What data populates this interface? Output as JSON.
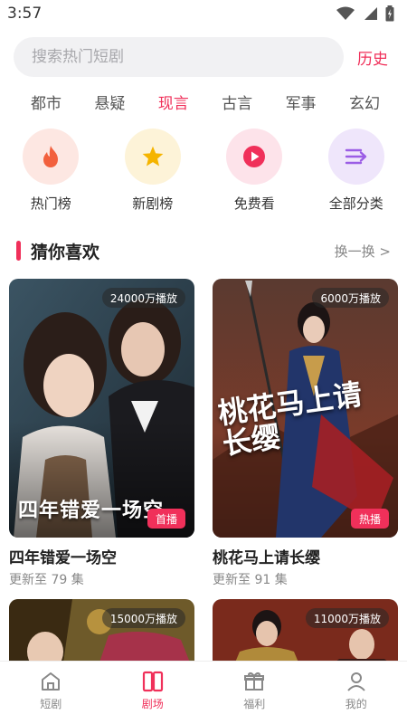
{
  "status_bar": {
    "time": "3:57"
  },
  "search": {
    "placeholder": "搜索热门短剧",
    "history_label": "历史"
  },
  "category_tabs": [
    {
      "label": "都市"
    },
    {
      "label": "悬疑"
    },
    {
      "label": "现言",
      "active": true
    },
    {
      "label": "古言"
    },
    {
      "label": "军事"
    },
    {
      "label": "玄幻"
    }
  ],
  "quick_entries": [
    {
      "label": "热门榜",
      "icon": "flame-icon",
      "bg": "#fde7e2",
      "color": "#f2603d"
    },
    {
      "label": "新剧榜",
      "icon": "star-icon",
      "bg": "#fdf3d8",
      "color": "#f5b400"
    },
    {
      "label": "免费看",
      "icon": "play-circle-icon",
      "bg": "#fde3ea",
      "color": "#f0305a"
    },
    {
      "label": "全部分类",
      "icon": "list-arrow-icon",
      "bg": "#efe6fb",
      "color": "#9b5de5"
    }
  ],
  "section": {
    "title": "猜你喜欢",
    "more_label": "换一换 >"
  },
  "cards": [
    {
      "plays": "24000万播放",
      "poster_title": "四年错爱一场空",
      "tag": "首播",
      "title": "四年错爱一场空",
      "subtitle": "更新至 79 集"
    },
    {
      "plays": "6000万播放",
      "poster_title": "桃花马上请长缨",
      "tag": "热播",
      "title": "桃花马上请长缨",
      "subtitle": "更新至 91 集"
    },
    {
      "plays": "15000万播放"
    },
    {
      "plays": "11000万播放"
    }
  ],
  "bottom_nav": [
    {
      "label": "短剧",
      "icon": "home-icon"
    },
    {
      "label": "剧场",
      "icon": "theater-icon",
      "active": true
    },
    {
      "label": "福利",
      "icon": "gift-icon"
    },
    {
      "label": "我的",
      "icon": "user-icon"
    }
  ],
  "colors": {
    "accent": "#f0305a",
    "inactive": "#888888"
  }
}
